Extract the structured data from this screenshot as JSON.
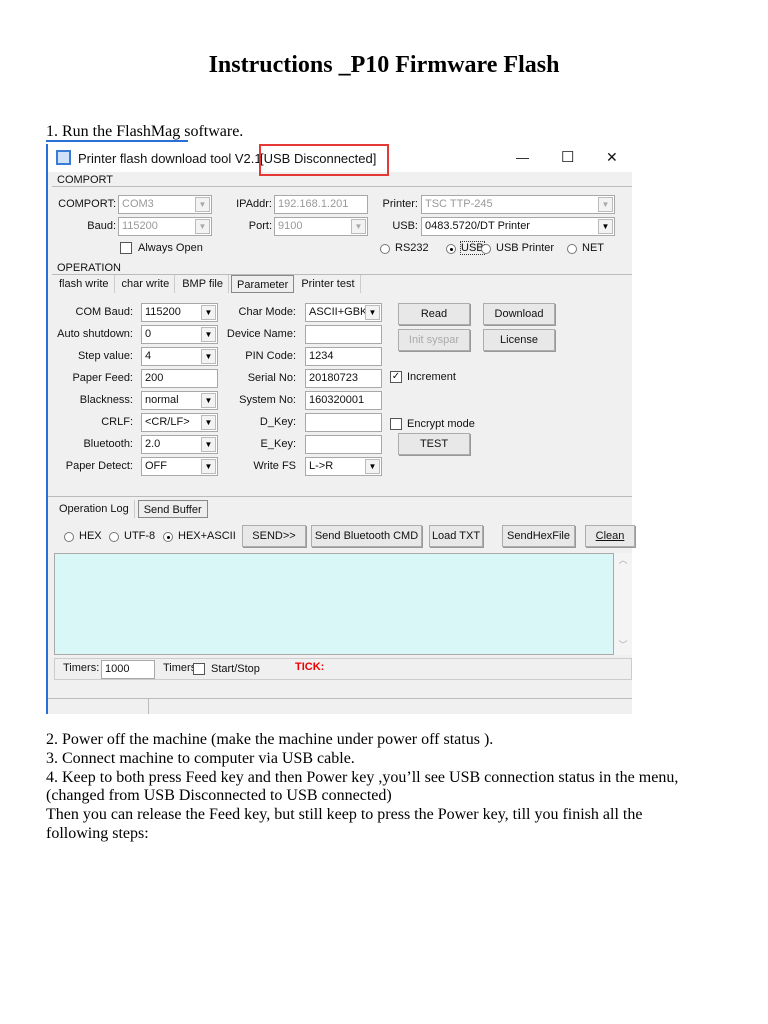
{
  "doc": {
    "title": "Instructions _P10 Firmware Flash",
    "step1": "1. Run the FlashMag software.",
    "lines": [
      "2. Power off the machine (make the machine under power off status ).",
      "3. Connect machine to computer via USB cable.",
      "4. Keep to both press Feed key and then Power key ,you’ll see USB connection status in the menu,",
      "(changed from USB Disconnected to USB connected)",
      "Then you can release the Feed key, but still keep to press the Power key, till you finish all the",
      "following steps:"
    ]
  },
  "app": {
    "title": "Printer flash download tool V2.1",
    "status": "[USB Disconnected]",
    "highlight_color": "#e53935",
    "controls": {
      "minimize": "—",
      "maximize": "☐",
      "close": "✕"
    },
    "comport": {
      "group": "COMPORT",
      "comport_label": "COMPORT:",
      "comport_value": "COM3",
      "baud_label": "Baud:",
      "baud_value": "115200",
      "ip_label": "IPAddr:",
      "ip_value": "192.168.1.201",
      "port_label": "Port:",
      "port_value": "9100",
      "printer_label": "Printer:",
      "printer_value": "TSC TTP-245",
      "usb_label": "USB:",
      "usb_value": "0483.5720/DT Printer",
      "always_open": "Always Open",
      "modes": [
        "RS232",
        "USB",
        "USB Printer",
        "NET"
      ],
      "selected_mode": "USB"
    },
    "operation": {
      "group": "OPERATION",
      "tabs": [
        "flash write",
        "char write",
        "BMP file",
        "Parameter",
        "Printer test"
      ],
      "active_tab": "Parameter"
    },
    "params_left": [
      {
        "label": "COM Baud:",
        "value": "115200"
      },
      {
        "label": "Auto shutdown:",
        "value": "0"
      },
      {
        "label": "Step value:",
        "value": "4"
      },
      {
        "label": "Paper Feed:",
        "value": "200",
        "text": true
      },
      {
        "label": "Blackness:",
        "value": "normal"
      },
      {
        "label": "CRLF:",
        "value": "<CR/LF>"
      },
      {
        "label": "Bluetooth:",
        "value": "2.0"
      },
      {
        "label": "Paper Detect:",
        "value": "OFF"
      }
    ],
    "params_mid": [
      {
        "label": "Char Mode:",
        "value": "ASCII+GBK",
        "combo": true
      },
      {
        "label": "Device Name:",
        "value": ""
      },
      {
        "label": "PIN Code:",
        "value": "1234"
      },
      {
        "label": "Serial No:",
        "value": "20180723"
      },
      {
        "label": "System No:",
        "value": "160320001"
      },
      {
        "label": "D_Key:",
        "value": ""
      },
      {
        "label": "E_Key:",
        "value": ""
      },
      {
        "label": "Write FS",
        "value": "L->R",
        "combo": true
      }
    ],
    "buttons": {
      "read": "Read",
      "download": "Download",
      "init": "Init syspar",
      "license": "License",
      "test": "TEST"
    },
    "increment": "Increment",
    "encrypt": "Encrypt mode",
    "log": {
      "tabs": [
        "Operation Log",
        "Send Buffer"
      ],
      "active_tab": "Send Buffer",
      "encodings": [
        "HEX",
        "UTF-8",
        "HEX+ASCII"
      ],
      "selected_encoding": "HEX+ASCII",
      "send": "SEND>>",
      "send_bt": "Send Bluetooth CMD",
      "load_txt": "Load TXT",
      "send_hex": "SendHexFile",
      "clean": "Clean",
      "buffer_color": "#d9f7f7"
    },
    "timer": {
      "label": "Timers:",
      "value": "1000",
      "label2": "Timers",
      "start_stop": "Start/Stop",
      "tick": "TICK:"
    }
  }
}
